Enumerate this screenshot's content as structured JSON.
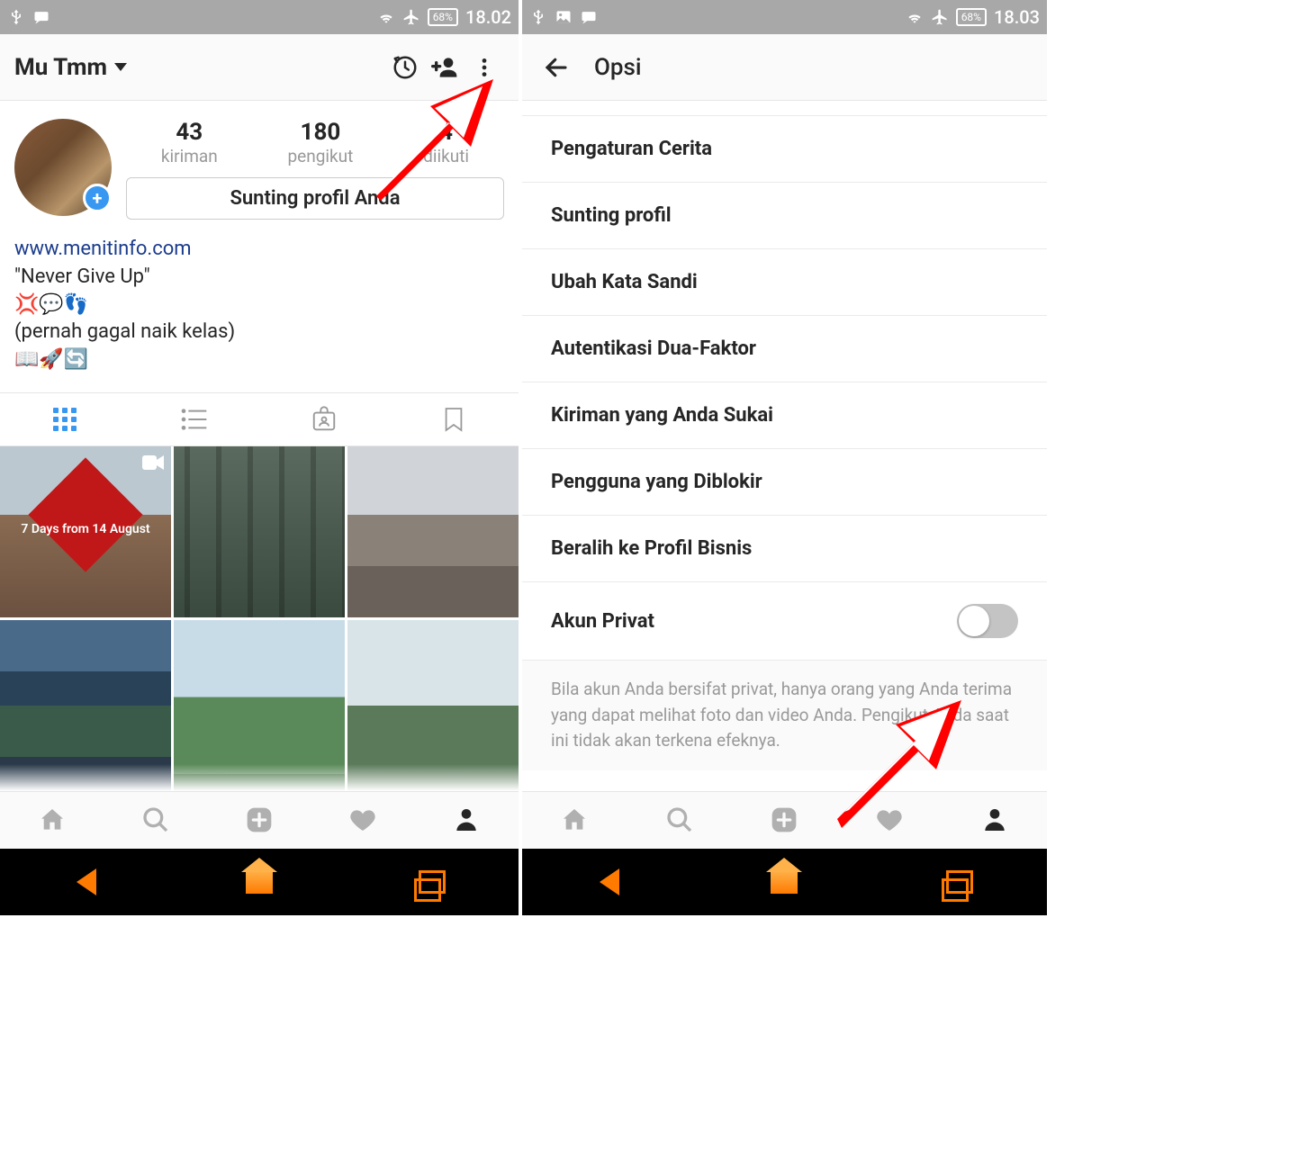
{
  "left": {
    "statusbar": {
      "battery": "68%",
      "time": "18.02"
    },
    "toolbar": {
      "username": "Mu Tmm"
    },
    "stats": {
      "posts": {
        "num": "43",
        "label": "kiriman"
      },
      "followers": {
        "num": "180",
        "label": "pengikut"
      },
      "following": {
        "num_partial": "4",
        "label": "diikuti"
      }
    },
    "edit_button": "Sunting profil Anda",
    "bio": {
      "link": "www.menitinfo.com",
      "line1": "\"Never Give Up\"",
      "emoji1": "💢💬👣",
      "line2": "(pernah gagal naik kelas)",
      "emoji2": "📖🚀🔄"
    },
    "grid_overlay": "7 Days from 14 August"
  },
  "right": {
    "statusbar": {
      "battery": "68%",
      "time": "18.03"
    },
    "toolbar": {
      "title": "Opsi"
    },
    "options": [
      "Pengaturan Cerita",
      "Sunting profil",
      "Ubah Kata Sandi",
      "Autentikasi Dua-Faktor",
      "Kiriman yang Anda Sukai",
      "Pengguna yang Diblokir",
      "Beralih ke Profil Bisnis",
      "Akun Privat"
    ],
    "private_desc": "Bila akun Anda bersifat privat, hanya orang yang Anda terima yang dapat melihat foto dan video Anda. Pengikut Anda saat ini tidak akan terkena efeknya."
  }
}
